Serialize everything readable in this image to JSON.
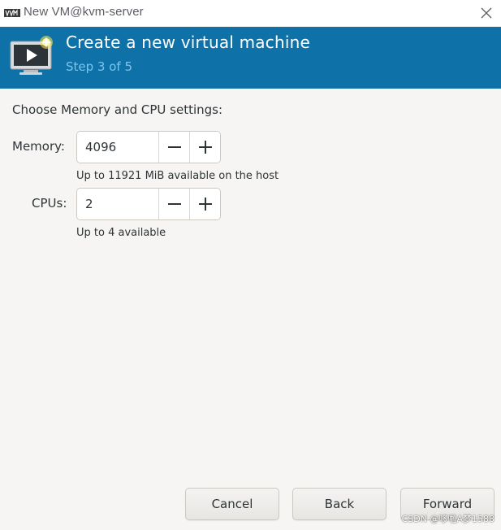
{
  "window": {
    "title": "New VM@kvm-server",
    "app_icon": "virt-manager-icon",
    "close_icon": "close-icon"
  },
  "banner": {
    "title": "Create a new virtual machine",
    "step": "Step 3 of 5",
    "icon": "monitor-new-vm-icon",
    "background_color": "#0e72a8",
    "step_color": "#7bc4ee"
  },
  "form": {
    "heading": "Choose Memory and CPU settings:",
    "memory": {
      "label": "Memory:",
      "value": "4096",
      "hint": "Up to 11921 MiB available on the host",
      "decrement_icon": "minus-icon",
      "increment_icon": "plus-icon"
    },
    "cpus": {
      "label": "CPUs:",
      "value": "2",
      "hint": "Up to 4 available",
      "decrement_icon": "minus-icon",
      "increment_icon": "plus-icon"
    }
  },
  "footer": {
    "cancel_label": "Cancel",
    "back_label": "Back",
    "forward_label": "Forward"
  },
  "watermark": {
    "text": "CSDN @哆啦A梦1588"
  }
}
